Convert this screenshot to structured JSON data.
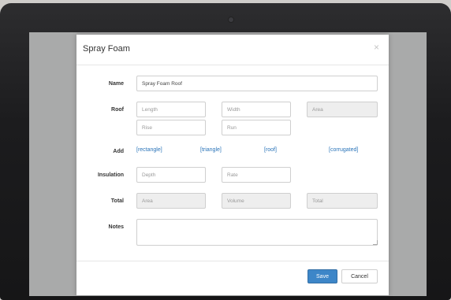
{
  "dialog": {
    "title": "Spray Foam",
    "close_glyph": "×"
  },
  "form": {
    "name_label": "Name",
    "name_value": "Spray Foam Roof",
    "roof_label": "Roof",
    "roof_length_placeholder": "Length",
    "roof_width_placeholder": "Width",
    "roof_area_placeholder": "Area",
    "roof_rise1_placeholder": "Rise",
    "roof_rise2_placeholder": "Run",
    "add_label": "Add",
    "add_links": [
      "[rectangle]",
      "[triangle]",
      "[roof]",
      "[corrugated]"
    ],
    "insulation_label": "Insulation",
    "insulation_depth_placeholder": "Depth",
    "insulation_rate_placeholder": "Rate",
    "total_label": "Total",
    "total_area_placeholder": "Area",
    "total_volume_placeholder": "Volume",
    "total_total_placeholder": "Total",
    "notes_label": "Notes",
    "notes_value": ""
  },
  "footer": {
    "save_label": "Save",
    "cancel_label": "Cancel"
  },
  "colors": {
    "accent": "#3d86c8",
    "link": "#2a74b9",
    "overlay": "#a9aaaa"
  }
}
